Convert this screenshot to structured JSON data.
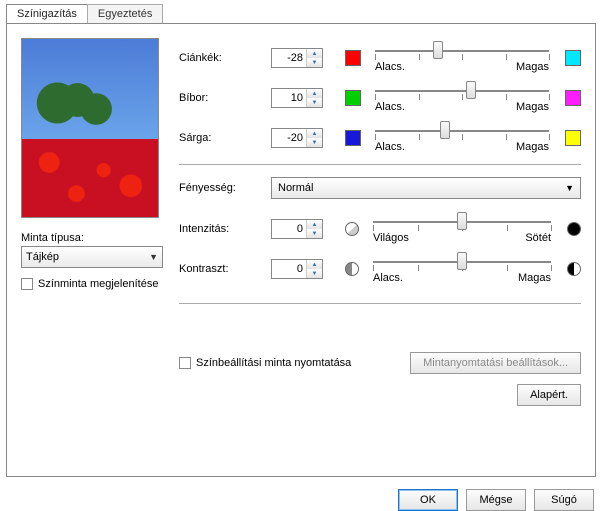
{
  "tabs": {
    "active": "Színigazítás",
    "inactive": "Egyeztetés"
  },
  "left": {
    "sample_type_label": "Minta típusa:",
    "sample_type_value": "Tájkép",
    "show_sample_label": "Színminta megjelenítése"
  },
  "bal": {
    "cyan": {
      "label": "Ciánkék:",
      "value": "-28",
      "low": "Alacs.",
      "high": "Magas",
      "swLow": "#ff0000",
      "swHigh": "#00e8ff",
      "pos": 36
    },
    "magenta": {
      "label": "Bíbor:",
      "value": "10",
      "low": "Alacs.",
      "high": "Magas",
      "swLow": "#00d000",
      "swHigh": "#ff1eff",
      "pos": 55
    },
    "yellow": {
      "label": "Sárga:",
      "value": "-20",
      "low": "Alacs.",
      "high": "Magas",
      "swLow": "#1818d8",
      "swHigh": "#ffff00",
      "pos": 40
    }
  },
  "brightness": {
    "label": "Fényesség:",
    "value": "Normál"
  },
  "adj": {
    "intensity": {
      "label": "Intenzitás:",
      "value": "0",
      "low": "Világos",
      "high": "Sötét",
      "pos": 50
    },
    "contrast": {
      "label": "Kontraszt:",
      "value": "0",
      "low": "Alacs.",
      "high": "Magas",
      "pos": 50
    }
  },
  "print_sample": {
    "label": "Színbeállítási minta nyomtatása"
  },
  "buttons": {
    "pattern": "Mintanyomtatási beállítások...",
    "defaults": "Alapért.",
    "ok": "OK",
    "cancel": "Mégse",
    "help": "Súgó"
  }
}
